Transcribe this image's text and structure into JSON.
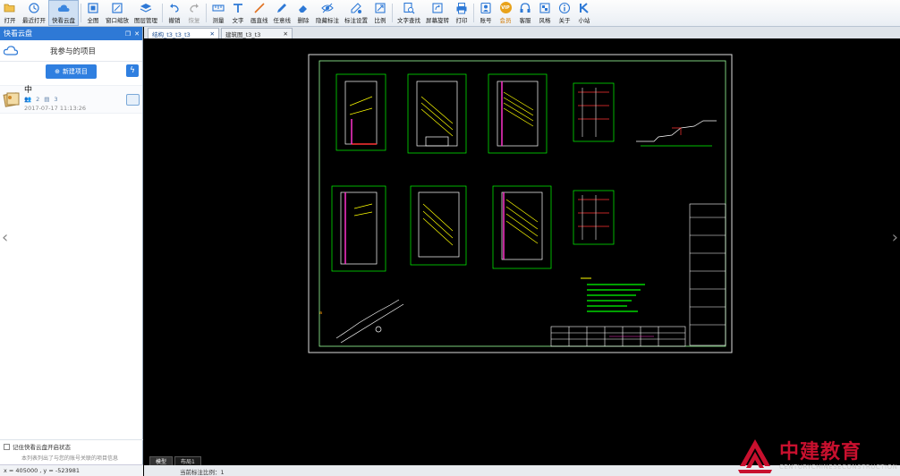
{
  "toolbar": {
    "buttons": [
      {
        "label": "打开",
        "icon": "folder-open-icon"
      },
      {
        "label": "最近打开",
        "icon": "clock-icon"
      },
      {
        "label": "快看云盘",
        "icon": "cloud-icon",
        "active": true
      },
      {
        "label": "全图",
        "icon": "fullscreen-icon"
      },
      {
        "label": "窗口缩放",
        "icon": "window-zoom-icon"
      },
      {
        "label": "图层管理",
        "icon": "layers-icon"
      },
      {
        "label": "撤销",
        "icon": "undo-icon"
      },
      {
        "label": "恢复",
        "icon": "redo-icon",
        "disabled": true
      },
      {
        "label": "测量",
        "icon": "ruler-icon"
      },
      {
        "label": "文字",
        "icon": "text-icon"
      },
      {
        "label": "画直线",
        "icon": "line-icon"
      },
      {
        "label": "任意线",
        "icon": "pencil-icon"
      },
      {
        "label": "删除",
        "icon": "eraser-icon"
      },
      {
        "label": "隐藏标注",
        "icon": "eye-icon"
      },
      {
        "label": "标注设置",
        "icon": "annotation-settings-icon"
      },
      {
        "label": "比例",
        "icon": "scale-icon"
      },
      {
        "label": "文字查找",
        "icon": "search-text-icon"
      },
      {
        "label": "屏幕旋转",
        "icon": "rotate-icon"
      },
      {
        "label": "打印",
        "icon": "printer-icon"
      },
      {
        "label": "账号",
        "icon": "user-icon"
      },
      {
        "label": "会员",
        "icon": "vip-icon",
        "vip": true
      },
      {
        "label": "客服",
        "icon": "headset-icon"
      },
      {
        "label": "风格",
        "icon": "palette-icon"
      },
      {
        "label": "关于",
        "icon": "info-icon"
      },
      {
        "label": "小站",
        "icon": "k-logo-icon"
      }
    ],
    "vip_badge": "VIP"
  },
  "sidebar": {
    "header": "快看云盘",
    "title": "我参与的项目",
    "new_project": "新建项目",
    "project": {
      "name": "中",
      "members": "2",
      "files": "3",
      "date": "2017-07-17 11:13:26"
    },
    "remember_label": "记住快看云盘开启状态",
    "tip": "本列表列出了与您的账号关联的项目信息"
  },
  "coords_text": "x = 405000 , y = -523981",
  "tabs": [
    {
      "label": "结构_t3_t3_t3",
      "active": true
    },
    {
      "label": "建筑图_t3_t3",
      "active": false
    }
  ],
  "layout_tabs": [
    {
      "label": "模型",
      "active": true
    },
    {
      "label": "布局1",
      "active": false
    }
  ],
  "status_text": "当前标注比例：1",
  "logo": {
    "cn": "中建教育",
    "en": "CENTURYCHINESECONSTRUCTION"
  },
  "colors": {
    "accent": "#2e79d6",
    "drawing_frame": "#ffffff",
    "drawing_green": "#00ff00",
    "drawing_yellow": "#ffff00",
    "drawing_red": "#ff3333",
    "logo_red": "#c8102e"
  }
}
